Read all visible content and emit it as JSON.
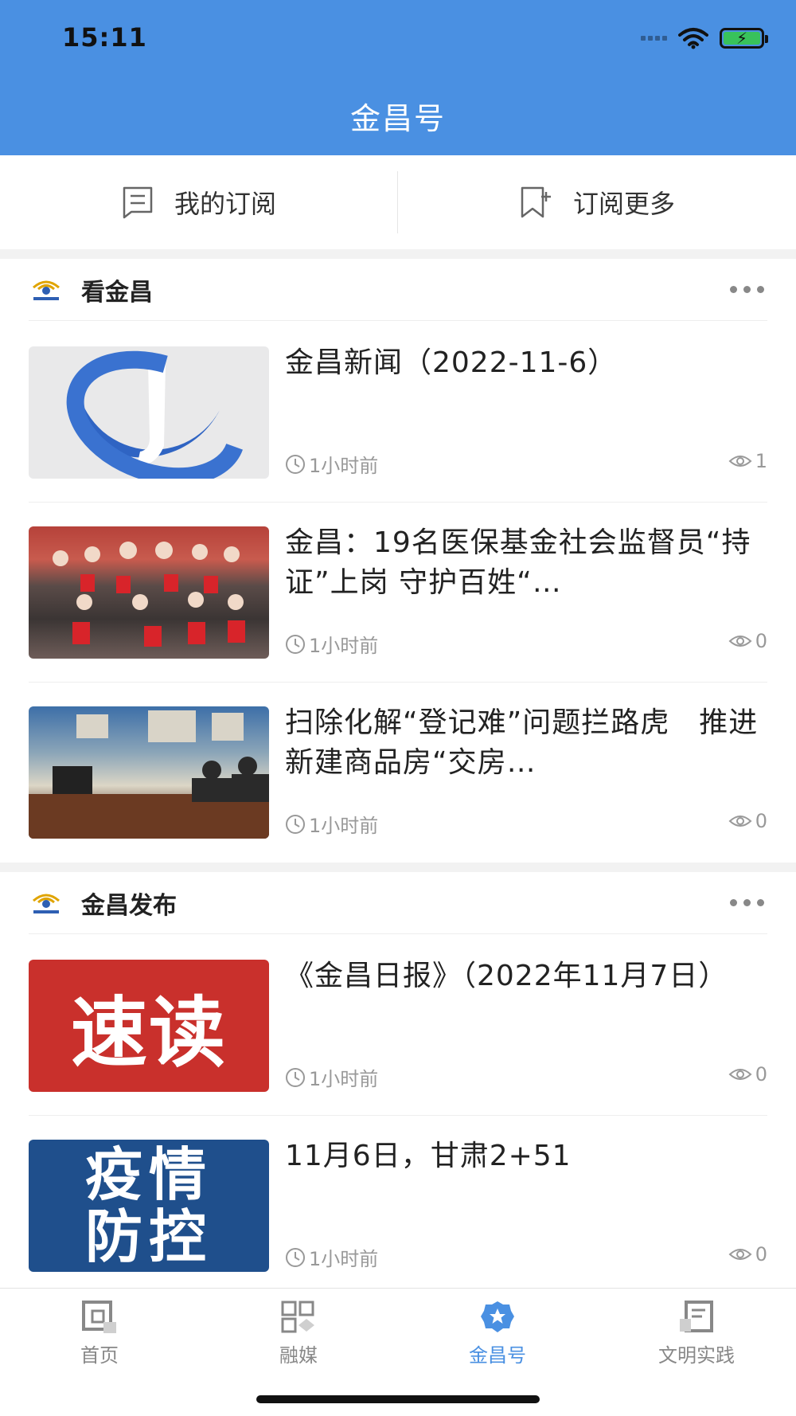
{
  "status_bar": {
    "time": "15:11"
  },
  "header": {
    "title": "金昌号"
  },
  "subscribe_bar": {
    "my_subscriptions": "我的订阅",
    "subscribe_more": "订阅更多"
  },
  "sections": [
    {
      "title": "看金昌",
      "items": [
        {
          "title": "金昌新闻（2022-11-6）",
          "time": "1小时前",
          "views": "1",
          "thumb": "logo"
        },
        {
          "title": "金昌：19名医保基金社会监督员“持证”上岗 守护百姓“…",
          "time": "1小时前",
          "views": "0",
          "thumb": "photo"
        },
        {
          "title": "扫除化解“登记难”问题拦路虎　推进新建商品房“交房…",
          "time": "1小时前",
          "views": "0",
          "thumb": "photo"
        }
      ]
    },
    {
      "title": "金昌发布",
      "items": [
        {
          "title": "《金昌日报》（2022年11月7日）",
          "time": "1小时前",
          "views": "0",
          "thumb_text": "速读"
        },
        {
          "title": "11月6日，甘肃2+51",
          "time": "1小时前",
          "views": "0",
          "thumb_text_1": "疫情",
          "thumb_text_2": "防控"
        }
      ]
    }
  ],
  "tab_bar": {
    "tabs": [
      {
        "label": "首页",
        "icon": "home-icon"
      },
      {
        "label": "融媒",
        "icon": "grid-icon"
      },
      {
        "label": "金昌号",
        "icon": "star-badge-icon"
      },
      {
        "label": "文明实践",
        "icon": "document-icon"
      }
    ],
    "active_color": "#4a90e2"
  },
  "colors": {
    "header": "#4a90e2",
    "meta_text": "#999999"
  }
}
